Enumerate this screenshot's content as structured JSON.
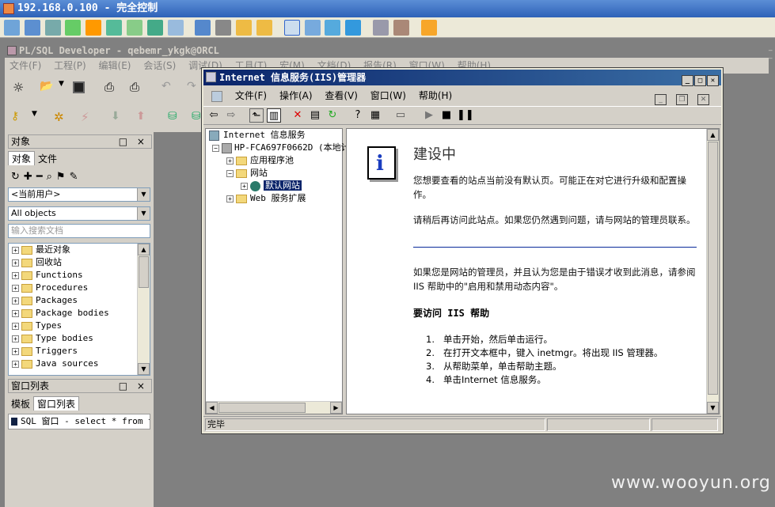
{
  "remote": {
    "title": "192.168.0.100 - 完全控制"
  },
  "plsql": {
    "title": "PL/SQL Developer - qebemr_ykgk@ORCL",
    "menu": [
      "文件(F)",
      "工程(P)",
      "编辑(E)",
      "会话(S)",
      "调试(D)",
      "工具(T)",
      "宏(M)",
      "文档(D)",
      "报告(R)",
      "窗口(W)",
      "帮助(H)"
    ]
  },
  "objects_pane": {
    "title": "对象",
    "controls": "□ ×",
    "tabs": [
      "对象",
      "文件"
    ],
    "user_combo": "<当前用户>",
    "filter_combo": "All objects",
    "search_placeholder": "输入搜索文档",
    "tree": [
      "最近对象",
      "回收站",
      "Functions",
      "Procedures",
      "Packages",
      "Package bodies",
      "Types",
      "Type bodies",
      "Triggers",
      "Java sources"
    ]
  },
  "window_list_pane": {
    "title": "窗口列表",
    "controls": "□ ×",
    "tabs": [
      "模板",
      "窗口列表"
    ],
    "item": "SQL 窗口 - select * from t_"
  },
  "iis": {
    "title": "Internet 信息服务(IIS)管理器",
    "menu": [
      "文件(F)",
      "操作(A)",
      "查看(V)",
      "窗口(W)",
      "帮助(H)"
    ],
    "tree": {
      "root": "Internet 信息服务",
      "server": "HP-FCA697F0662D (本地计",
      "app_pools": "应用程序池",
      "websites": "网站",
      "default_site": "默认网站",
      "web_ext": "Web 服务扩展"
    },
    "content": {
      "heading": "建设中",
      "p1": "您想要查看的站点当前没有默认页。可能正在对它进行升级和配置操作。",
      "p2": "请稍后再访问此站点。如果您仍然遇到问题，请与网站的管理员联系。",
      "p3": "如果您是网站的管理员，并且认为您是由于错误才收到此消息，请参阅 IIS 帮助中的\"启用和禁用动态内容\"。",
      "h2": "要访问 IIS 帮助",
      "steps": [
        {
          "n": "1.",
          "text": "单击开始，然后单击运行。"
        },
        {
          "n": "2.",
          "text": "在打开文本框中，键入 inetmgr。将出现 IIS 管理器。"
        },
        {
          "n": "3.",
          "text": "从帮助菜单，单击帮助主题。"
        },
        {
          "n": "4.",
          "text": "单击Internet 信息服务。"
        }
      ]
    },
    "status": "完毕"
  },
  "watermark": "www.wooyun.org"
}
